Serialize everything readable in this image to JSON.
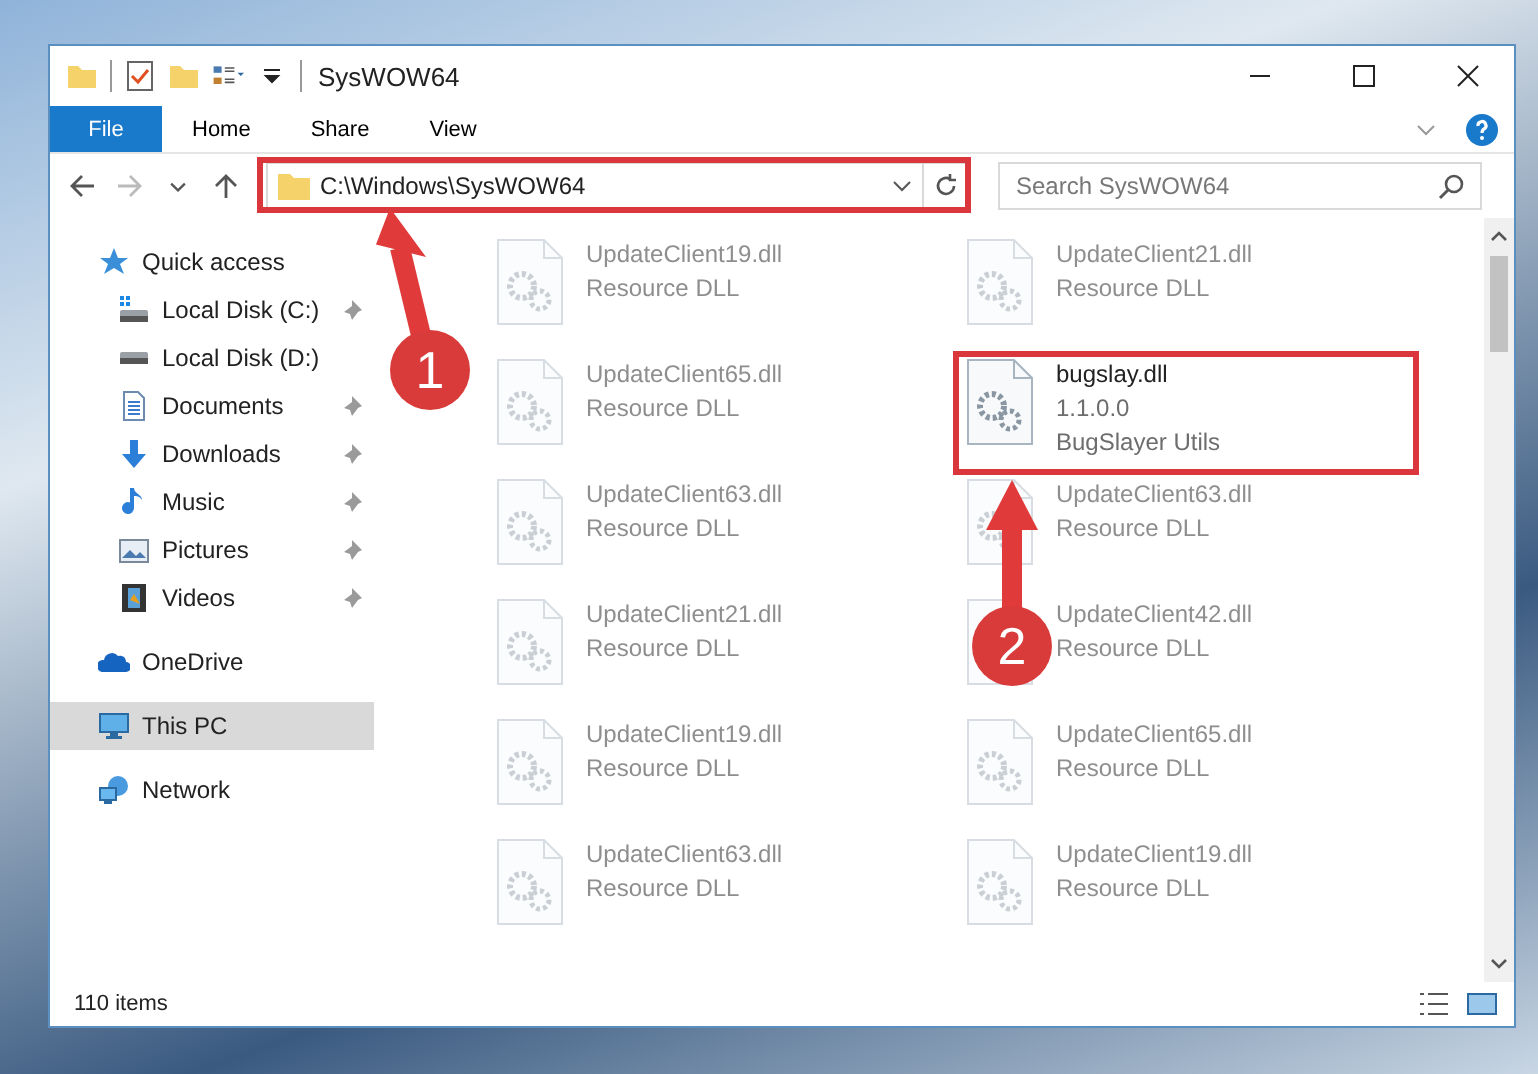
{
  "window": {
    "title": "SysWOW64"
  },
  "ribbon": {
    "tabs": [
      {
        "label": "File",
        "kind": "file"
      },
      {
        "label": "Home",
        "kind": "tab"
      },
      {
        "label": "Share",
        "kind": "tab"
      },
      {
        "label": "View",
        "kind": "tab"
      }
    ]
  },
  "address_bar": {
    "path": "C:\\Windows\\SysWOW64"
  },
  "search": {
    "placeholder": "Search SysWOW64"
  },
  "nav": {
    "items": [
      {
        "label": "Quick access",
        "kind": "star",
        "selected": false,
        "children": [
          {
            "label": "Local Disk (C:)",
            "kind": "system-drive",
            "pinned": true,
            "selected": false
          },
          {
            "label": "Local Disk (D:)",
            "kind": "drive",
            "pinned": false,
            "selected": false
          },
          {
            "label": "Documents",
            "kind": "documents",
            "pinned": true,
            "selected": false
          },
          {
            "label": "Downloads",
            "kind": "downloads",
            "pinned": true,
            "selected": false
          },
          {
            "label": "Music",
            "kind": "music",
            "pinned": true,
            "selected": false
          },
          {
            "label": "Pictures",
            "kind": "pictures",
            "pinned": true,
            "selected": false
          },
          {
            "label": "Videos",
            "kind": "videos",
            "pinned": true,
            "selected": false
          }
        ]
      },
      {
        "label": "OneDrive",
        "kind": "cloud",
        "selected": false
      },
      {
        "label": "This PC",
        "kind": "pc",
        "selected": true
      },
      {
        "label": "Network",
        "kind": "network",
        "selected": false
      }
    ]
  },
  "files": [
    {
      "name": "UpdateClient19.dll",
      "lines": [
        "Resource DLL"
      ],
      "emphasized": false
    },
    {
      "name": "UpdateClient21.dll",
      "lines": [
        "Resource DLL"
      ],
      "emphasized": false
    },
    {
      "name": "UpdateClient65.dll",
      "lines": [
        "Resource DLL"
      ],
      "emphasized": false
    },
    {
      "name": "bugslay.dll",
      "lines": [
        "1.1.0.0",
        "BugSlayer Utils"
      ],
      "emphasized": true
    },
    {
      "name": "UpdateClient63.dll",
      "lines": [
        "Resource DLL"
      ],
      "emphasized": false
    },
    {
      "name": "UpdateClient63.dll",
      "lines": [
        "Resource DLL"
      ],
      "emphasized": false
    },
    {
      "name": "UpdateClient21.dll",
      "lines": [
        "Resource DLL"
      ],
      "emphasized": false
    },
    {
      "name": "UpdateClient42.dll",
      "lines": [
        "Resource DLL"
      ],
      "emphasized": false
    },
    {
      "name": "UpdateClient19.dll",
      "lines": [
        "Resource DLL"
      ],
      "emphasized": false
    },
    {
      "name": "UpdateClient65.dll",
      "lines": [
        "Resource DLL"
      ],
      "emphasized": false
    },
    {
      "name": "UpdateClient63.dll",
      "lines": [
        "Resource DLL"
      ],
      "emphasized": false
    },
    {
      "name": "UpdateClient19.dll",
      "lines": [
        "Resource DLL"
      ],
      "emphasized": false
    }
  ],
  "status_bar": {
    "count": "110 items"
  },
  "annotations": [
    {
      "number": "1"
    },
    {
      "number": "2"
    }
  ]
}
